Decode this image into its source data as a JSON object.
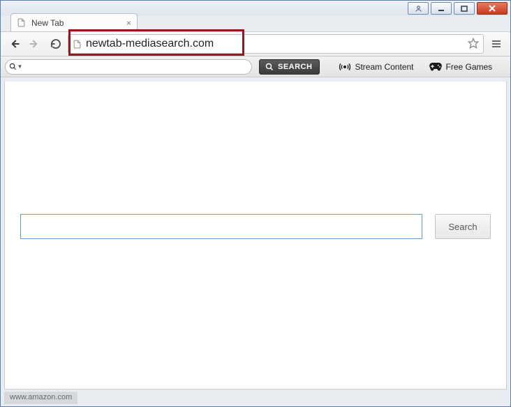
{
  "window": {
    "user_btn_title": "You",
    "minimize_title": "Minimize",
    "maximize_title": "Maximize",
    "close_title": "Close"
  },
  "tab": {
    "title": "New Tab",
    "close_title": "Close tab"
  },
  "nav": {
    "back_title": "Back",
    "forward_title": "Forward",
    "reload_title": "Reload",
    "url": "newtab-mediasearch.com",
    "star_title": "Bookmark",
    "menu_title": "Menu"
  },
  "toolbar": {
    "dropdown_title": "Search engine",
    "search_placeholder": "",
    "search_button": "SEARCH",
    "stream_label": "Stream Content",
    "games_label": "Free Games"
  },
  "page": {
    "search_placeholder": "",
    "search_value": "",
    "search_button": "Search"
  },
  "status": {
    "text": "www.amazon.com"
  }
}
